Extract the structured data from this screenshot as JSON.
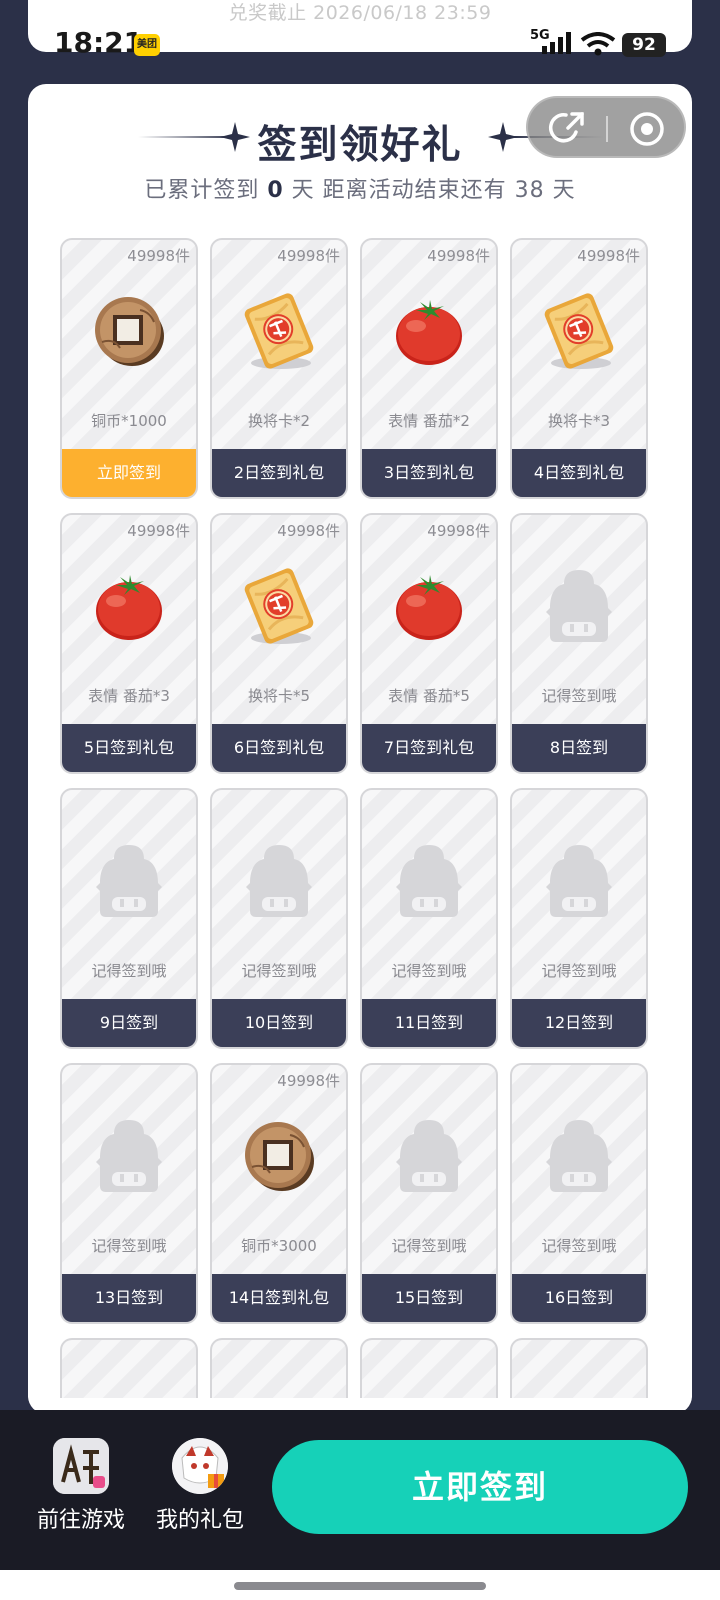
{
  "top_card": {
    "deadline": "兑奖截止 2026/06/18 23:59"
  },
  "status_bar": {
    "time": "18:21",
    "app_badge": "美团",
    "network": "5G",
    "battery": "92"
  },
  "header": {
    "title": "签到领好礼",
    "subtitle_prefix": "已累计签到",
    "signed_days": "0",
    "subtitle_suffix": "天  距离活动结束还有 38 天"
  },
  "tiles": [
    {
      "stock": "49998件",
      "icon": "coin",
      "name": "铜币*1000",
      "day": "立即签到",
      "today": true
    },
    {
      "stock": "49998件",
      "icon": "card",
      "name": "换将卡*2",
      "day": "2日签到礼包"
    },
    {
      "stock": "49998件",
      "icon": "tomato",
      "name": "表情 番茄*2",
      "day": "3日签到礼包"
    },
    {
      "stock": "49998件",
      "icon": "card",
      "name": "换将卡*3",
      "day": "4日签到礼包"
    },
    {
      "stock": "49998件",
      "icon": "tomato",
      "name": "表情 番茄*3",
      "day": "5日签到礼包"
    },
    {
      "stock": "49998件",
      "icon": "card",
      "name": "换将卡*5",
      "day": "6日签到礼包"
    },
    {
      "stock": "49998件",
      "icon": "tomato",
      "name": "表情 番茄*5",
      "day": "7日签到礼包"
    },
    {
      "stock": "",
      "icon": "ghost",
      "name": "记得签到哦",
      "day": "8日签到"
    },
    {
      "stock": "",
      "icon": "ghost",
      "name": "记得签到哦",
      "day": "9日签到"
    },
    {
      "stock": "",
      "icon": "ghost",
      "name": "记得签到哦",
      "day": "10日签到"
    },
    {
      "stock": "",
      "icon": "ghost",
      "name": "记得签到哦",
      "day": "11日签到"
    },
    {
      "stock": "",
      "icon": "ghost",
      "name": "记得签到哦",
      "day": "12日签到"
    },
    {
      "stock": "",
      "icon": "ghost",
      "name": "记得签到哦",
      "day": "13日签到"
    },
    {
      "stock": "49998件",
      "icon": "coin",
      "name": "铜币*3000",
      "day": "14日签到礼包"
    },
    {
      "stock": "",
      "icon": "ghost",
      "name": "记得签到哦",
      "day": "15日签到"
    },
    {
      "stock": "",
      "icon": "ghost",
      "name": "记得签到哦",
      "day": "16日签到"
    }
  ],
  "bottom_bar": {
    "game_label": "前往游戏",
    "gifts_label": "我的礼包",
    "sign_button": "立即签到"
  },
  "colors": {
    "accent": "#16d1b8",
    "today": "#fdb02f",
    "dark": "#2b3048"
  }
}
